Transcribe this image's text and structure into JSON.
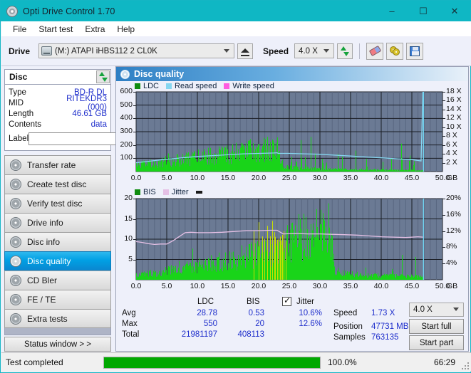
{
  "window": {
    "title": "Opti Drive Control 1.70",
    "icon": "disc-icon",
    "minimize": "–",
    "maximize": "☐",
    "close": "✕"
  },
  "menu": {
    "items": [
      "File",
      "Start test",
      "Extra",
      "Help"
    ]
  },
  "toolbar": {
    "drive_label": "Drive",
    "drive_value": "(M:)   ATAPI iHBS112  2 CL0K",
    "eject_label": "eject",
    "speed_label": "Speed",
    "speed_value": "4.0 X",
    "buttons": [
      "refresh-icon",
      "erase-icon",
      "two-discs-icon",
      "save-icon"
    ]
  },
  "disc_panel": {
    "title": "Disc",
    "rows": [
      {
        "key": "Type",
        "value": "BD-R DL"
      },
      {
        "key": "MID",
        "value": "RITEKDR3 (000)"
      },
      {
        "key": "Length",
        "value": "46.61 GB"
      },
      {
        "key": "Contents",
        "value": "data"
      }
    ],
    "label_key": "Label",
    "label_value": "",
    "label_placeholder": ""
  },
  "sidebar": {
    "items": [
      {
        "label": "Transfer rate",
        "active": false
      },
      {
        "label": "Create test disc",
        "active": false
      },
      {
        "label": "Verify test disc",
        "active": false
      },
      {
        "label": "Drive info",
        "active": false
      },
      {
        "label": "Disc info",
        "active": false
      },
      {
        "label": "Disc quality",
        "active": true
      },
      {
        "label": "CD Bler",
        "active": false
      },
      {
        "label": "FE / TE",
        "active": false
      },
      {
        "label": "Extra tests",
        "active": false
      }
    ],
    "status_window_button": "Status window > >"
  },
  "main": {
    "panel_title": "Disc quality",
    "stats": {
      "col_headers": [
        "LDC",
        "BIS"
      ],
      "rows": [
        {
          "label": "Avg",
          "ldc": "28.78",
          "bis": "0.53"
        },
        {
          "label": "Max",
          "ldc": "550",
          "bis": "20"
        },
        {
          "label": "Total",
          "ldc": "21981197",
          "bis": "408113"
        }
      ],
      "jitter_label": "Jitter",
      "jitter_checked": true,
      "jitter_avg": "10.6%",
      "jitter_max": "12.6%",
      "speed_label": "Speed",
      "speed_value": "1.73 X",
      "position_label": "Position",
      "position_value": "47731 MB",
      "samples_label": "Samples",
      "samples_value": "763135",
      "speed_select": "4.0 X",
      "start_full": "Start full",
      "start_part": "Start part"
    }
  },
  "statusbar": {
    "status": "Test completed",
    "percent": "100.0%",
    "progress_value": 100,
    "elapsed": "66:29"
  },
  "colors": {
    "accent": "#0fb7c4",
    "plot_bg": "#6b7a94",
    "ldc_green": "#19d419",
    "bis_green": "#19d419",
    "bis_yellow": "#c8e000",
    "read_speed": "#86d6f0",
    "write_speed": "#ff5ce0",
    "jitter": "#e5c0e5",
    "value_blue": "#1e2ecb",
    "progress_green": "#00a800"
  },
  "chart_data": [
    {
      "type": "area",
      "id": "ldc-chart",
      "title": "LDC / Read speed / Write speed",
      "legend": [
        {
          "label": "LDC",
          "color": "#108c10"
        },
        {
          "label": "Read speed",
          "color": "#86d6f0"
        },
        {
          "label": "Write speed",
          "color": "#ff5ce0"
        }
      ],
      "legend_position": "top-left",
      "grid": true,
      "xlabel": "GB",
      "xlim": [
        0,
        50
      ],
      "xticks": [
        "0.0",
        "5.0",
        "10.0",
        "15.0",
        "20.0",
        "25.0",
        "30.0",
        "35.0",
        "40.0",
        "45.0",
        "50.0"
      ],
      "ylabel_left": "LDC",
      "ylim": [
        0,
        600
      ],
      "yticks": [
        "100",
        "200",
        "300",
        "400",
        "500",
        "600"
      ],
      "ylabel_right": "X",
      "ylim_right": [
        0,
        18
      ],
      "yticks_right": [
        "2 X",
        "4 X",
        "6 X",
        "8 X",
        "10 X",
        "12 X",
        "14 X",
        "16 X",
        "18 X"
      ],
      "series": [
        {
          "name": "LDC",
          "color": "#19d419",
          "kind": "spikes",
          "x": [
            0.2,
            0.6,
            1.0,
            1.4,
            1.8,
            2.2,
            2.6,
            3.0,
            3.4,
            3.8,
            4.2,
            4.6,
            5.0,
            5.4,
            5.8,
            6.2,
            6.6,
            7.0,
            7.4,
            7.8,
            8.2,
            8.6,
            9.0,
            9.4,
            9.8,
            10.2,
            10.6,
            11.0,
            11.4,
            11.8,
            12.2,
            12.6,
            13.0,
            13.4,
            13.8,
            14.2,
            14.6,
            15.0,
            15.4,
            15.8,
            16.2,
            16.6,
            17.0,
            17.4,
            17.8,
            18.2,
            18.6,
            19.0,
            19.4,
            19.8,
            20.2,
            20.6,
            21.0,
            21.4,
            21.8,
            22.2,
            22.6,
            23.0,
            23.4,
            23.8,
            24.2,
            24.6,
            25.0,
            25.4,
            25.8,
            26.2,
            26.6,
            27.0,
            27.4,
            27.8,
            28.2,
            28.6,
            29.0,
            29.4,
            29.8,
            30.2,
            30.6,
            31.0,
            31.4,
            31.8,
            32.2,
            32.6,
            33.0,
            33.4,
            33.8,
            34.2,
            34.6,
            35.0,
            35.4,
            35.8,
            36.2,
            36.6,
            37.0,
            37.4,
            37.8,
            38.2,
            38.6,
            39.0,
            39.4,
            39.8,
            40.2,
            40.6,
            41.0,
            41.4,
            41.8,
            42.2,
            42.6,
            43.0,
            43.4,
            43.8,
            44.2,
            44.6,
            45.0,
            45.4,
            45.8,
            46.2,
            46.6
          ],
          "baseline": [
            40,
            45,
            48,
            50,
            52,
            55,
            57,
            58,
            60,
            62,
            64,
            66,
            68,
            70,
            72,
            75,
            78,
            80,
            83,
            86,
            88,
            90,
            92,
            95,
            97,
            100,
            102,
            104,
            106,
            108,
            110,
            112,
            114,
            116,
            118,
            120,
            122,
            125,
            128,
            130,
            132,
            135,
            138,
            140,
            142,
            145,
            148,
            150,
            152,
            155,
            158,
            160,
            162,
            165,
            168,
            170,
            60,
            40,
            35,
            30,
            28,
            26,
            25,
            24,
            23,
            22,
            21,
            20,
            20,
            19,
            19,
            18,
            18,
            18,
            17,
            17,
            17,
            16,
            16,
            16,
            15,
            15,
            15,
            15,
            14,
            14,
            14,
            14,
            13,
            13,
            13,
            13,
            12,
            12,
            12,
            12,
            12,
            11,
            11,
            11,
            11,
            10,
            10,
            10,
            10,
            10,
            9,
            9,
            9,
            9,
            8,
            8,
            8
          ],
          "peaks": [
            [
              1.1,
              150
            ],
            [
              2.3,
              140
            ],
            [
              3.1,
              145
            ],
            [
              4.8,
              200
            ],
            [
              5.2,
              210
            ],
            [
              7.4,
              150
            ],
            [
              9.2,
              170
            ],
            [
              10.3,
              175
            ],
            [
              12.1,
              180
            ],
            [
              13.4,
              165
            ],
            [
              14.9,
              210
            ],
            [
              15.3,
              235
            ],
            [
              16.1,
              225
            ],
            [
              17.6,
              320
            ],
            [
              17.9,
              300
            ],
            [
              18.6,
              270
            ],
            [
              19.1,
              330
            ],
            [
              19.8,
              300
            ],
            [
              20.5,
              335
            ],
            [
              21.1,
              430
            ],
            [
              21.6,
              310
            ],
            [
              22.2,
              280
            ],
            [
              22.6,
              260
            ],
            [
              23.4,
              240
            ],
            [
              23.8,
              175
            ],
            [
              25.3,
              230
            ],
            [
              26.1,
              200
            ],
            [
              26.9,
              465
            ],
            [
              27.6,
              240
            ],
            [
              28.5,
              300
            ],
            [
              29.2,
              210
            ],
            [
              30.4,
              225
            ],
            [
              31.0,
              165
            ],
            [
              32.9,
              150
            ],
            [
              33.6,
              140
            ],
            [
              35.8,
              225
            ],
            [
              37.6,
              170
            ],
            [
              40.2,
              140
            ],
            [
              41.6,
              160
            ],
            [
              43.3,
              420
            ],
            [
              44.6,
              250
            ],
            [
              45.3,
              200
            ]
          ]
        },
        {
          "name": "Read speed",
          "color": "#86d6f0",
          "kind": "line",
          "x": [
            0.0,
            2.5,
            5.0,
            7.5,
            10.0,
            12.5,
            15.0,
            17.5,
            20.0,
            22.5,
            23.0,
            23.2,
            25.0,
            27.5,
            30.0,
            32.5,
            35.0,
            37.5,
            40.0,
            42.5,
            45.0,
            46.5,
            46.8
          ],
          "y": [
            2.0,
            2.4,
            2.8,
            3.1,
            3.4,
            3.6,
            3.8,
            4.0,
            4.1,
            4.2,
            4.25,
            4.1,
            4.1,
            4.0,
            3.9,
            3.7,
            3.5,
            3.3,
            3.1,
            2.9,
            2.7,
            2.4,
            18.0
          ]
        },
        {
          "name": "Write speed",
          "color": "#ff5ce0",
          "kind": "line",
          "x": [],
          "y": []
        }
      ]
    },
    {
      "type": "area",
      "id": "bis-chart",
      "title": "BIS / Jitter",
      "legend": [
        {
          "label": "BIS",
          "color": "#108c10"
        },
        {
          "label": "Jitter",
          "color": "#e5c0e5"
        }
      ],
      "legend_position": "top-left",
      "grid": true,
      "xlabel": "GB",
      "xlim": [
        0,
        50
      ],
      "xticks": [
        "0.0",
        "5.0",
        "10.0",
        "15.0",
        "20.0",
        "25.0",
        "30.0",
        "35.0",
        "40.0",
        "45.0",
        "50.0"
      ],
      "ylabel_left": "BIS",
      "ylim": [
        0,
        20
      ],
      "yticks": [
        "5",
        "10",
        "15",
        "20"
      ],
      "ylabel_right": "%",
      "ylim_right": [
        0,
        20
      ],
      "yticks_right": [
        "4%",
        "8%",
        "12%",
        "16%",
        "20%"
      ],
      "series": [
        {
          "name": "BIS",
          "color": "#19d419",
          "kind": "spikes",
          "baseline": [
            1.2,
            1.3,
            1.4,
            1.5,
            1.6,
            1.8,
            2.0,
            2.2,
            2.4,
            2.6,
            2.8,
            3.0,
            3.2,
            3.4,
            3.6,
            3.8,
            4.0,
            4.2,
            4.5,
            4.8,
            5.0,
            5.3,
            5.5,
            5.8,
            6.0,
            6.5,
            7.0,
            7.5,
            8.0,
            8.5,
            9.0,
            9.5,
            10.0,
            10.5,
            11.0,
            11.5,
            11.8,
            12.0,
            2.0,
            1.6,
            1.4,
            1.3,
            1.2,
            1.1,
            1.0,
            1.0,
            1.0,
            0.9,
            0.9,
            0.9,
            0.8,
            0.8,
            0.8,
            0.8,
            0.7,
            0.7
          ],
          "peaks": [
            [
              7.0,
              6.2
            ],
            [
              9.2,
              9.5
            ],
            [
              10.4,
              11.2
            ],
            [
              11.8,
              9.0
            ],
            [
              12.6,
              8.0
            ],
            [
              13.4,
              8.6
            ],
            [
              14.2,
              7.6
            ],
            [
              15.2,
              12.4
            ],
            [
              16.0,
              13.4
            ],
            [
              16.8,
              14.0
            ],
            [
              17.6,
              13.6
            ],
            [
              18.4,
              14.2
            ],
            [
              19.2,
              14.6
            ],
            [
              20.0,
              15.0
            ],
            [
              20.6,
              15.6
            ],
            [
              21.0,
              20.0
            ],
            [
              21.4,
              16.8
            ],
            [
              21.8,
              15.8
            ],
            [
              22.2,
              17.2
            ],
            [
              22.6,
              16.4
            ],
            [
              23.0,
              15.4
            ],
            [
              24.0,
              16.2
            ],
            [
              24.4,
              15.0
            ],
            [
              26.0,
              5.0
            ],
            [
              27.2,
              5.4
            ],
            [
              28.6,
              5.6
            ],
            [
              30.6,
              5.4
            ],
            [
              33.0,
              4.6
            ],
            [
              37.4,
              5.2
            ],
            [
              41.8,
              6.2
            ],
            [
              43.4,
              8.8
            ],
            [
              45.6,
              7.6
            ]
          ]
        },
        {
          "name": "Jitter",
          "color": "#e5c0e5",
          "kind": "line",
          "x": [
            0.0,
            1.0,
            2.0,
            3.0,
            4.0,
            5.0,
            6.0,
            7.0,
            8.0,
            9.0,
            10.0,
            12.0,
            14.0,
            16.0,
            18.0,
            20.0,
            22.0,
            23.0,
            24.0,
            26.0,
            28.0,
            30.0,
            32.0,
            34.0,
            36.0,
            38.0,
            40.0,
            42.0,
            44.0,
            46.0,
            46.8
          ],
          "y": [
            9.4,
            9.2,
            8.9,
            8.7,
            8.8,
            8.8,
            9.6,
            10.6,
            11.6,
            11.7,
            11.6,
            11.6,
            11.7,
            11.9,
            12.1,
            12.1,
            12.2,
            12.2,
            11.3,
            11.4,
            11.3,
            11.3,
            11.2,
            11.1,
            11.0,
            10.8,
            10.6,
            10.5,
            10.4,
            10.6,
            10.5
          ]
        }
      ]
    }
  ]
}
